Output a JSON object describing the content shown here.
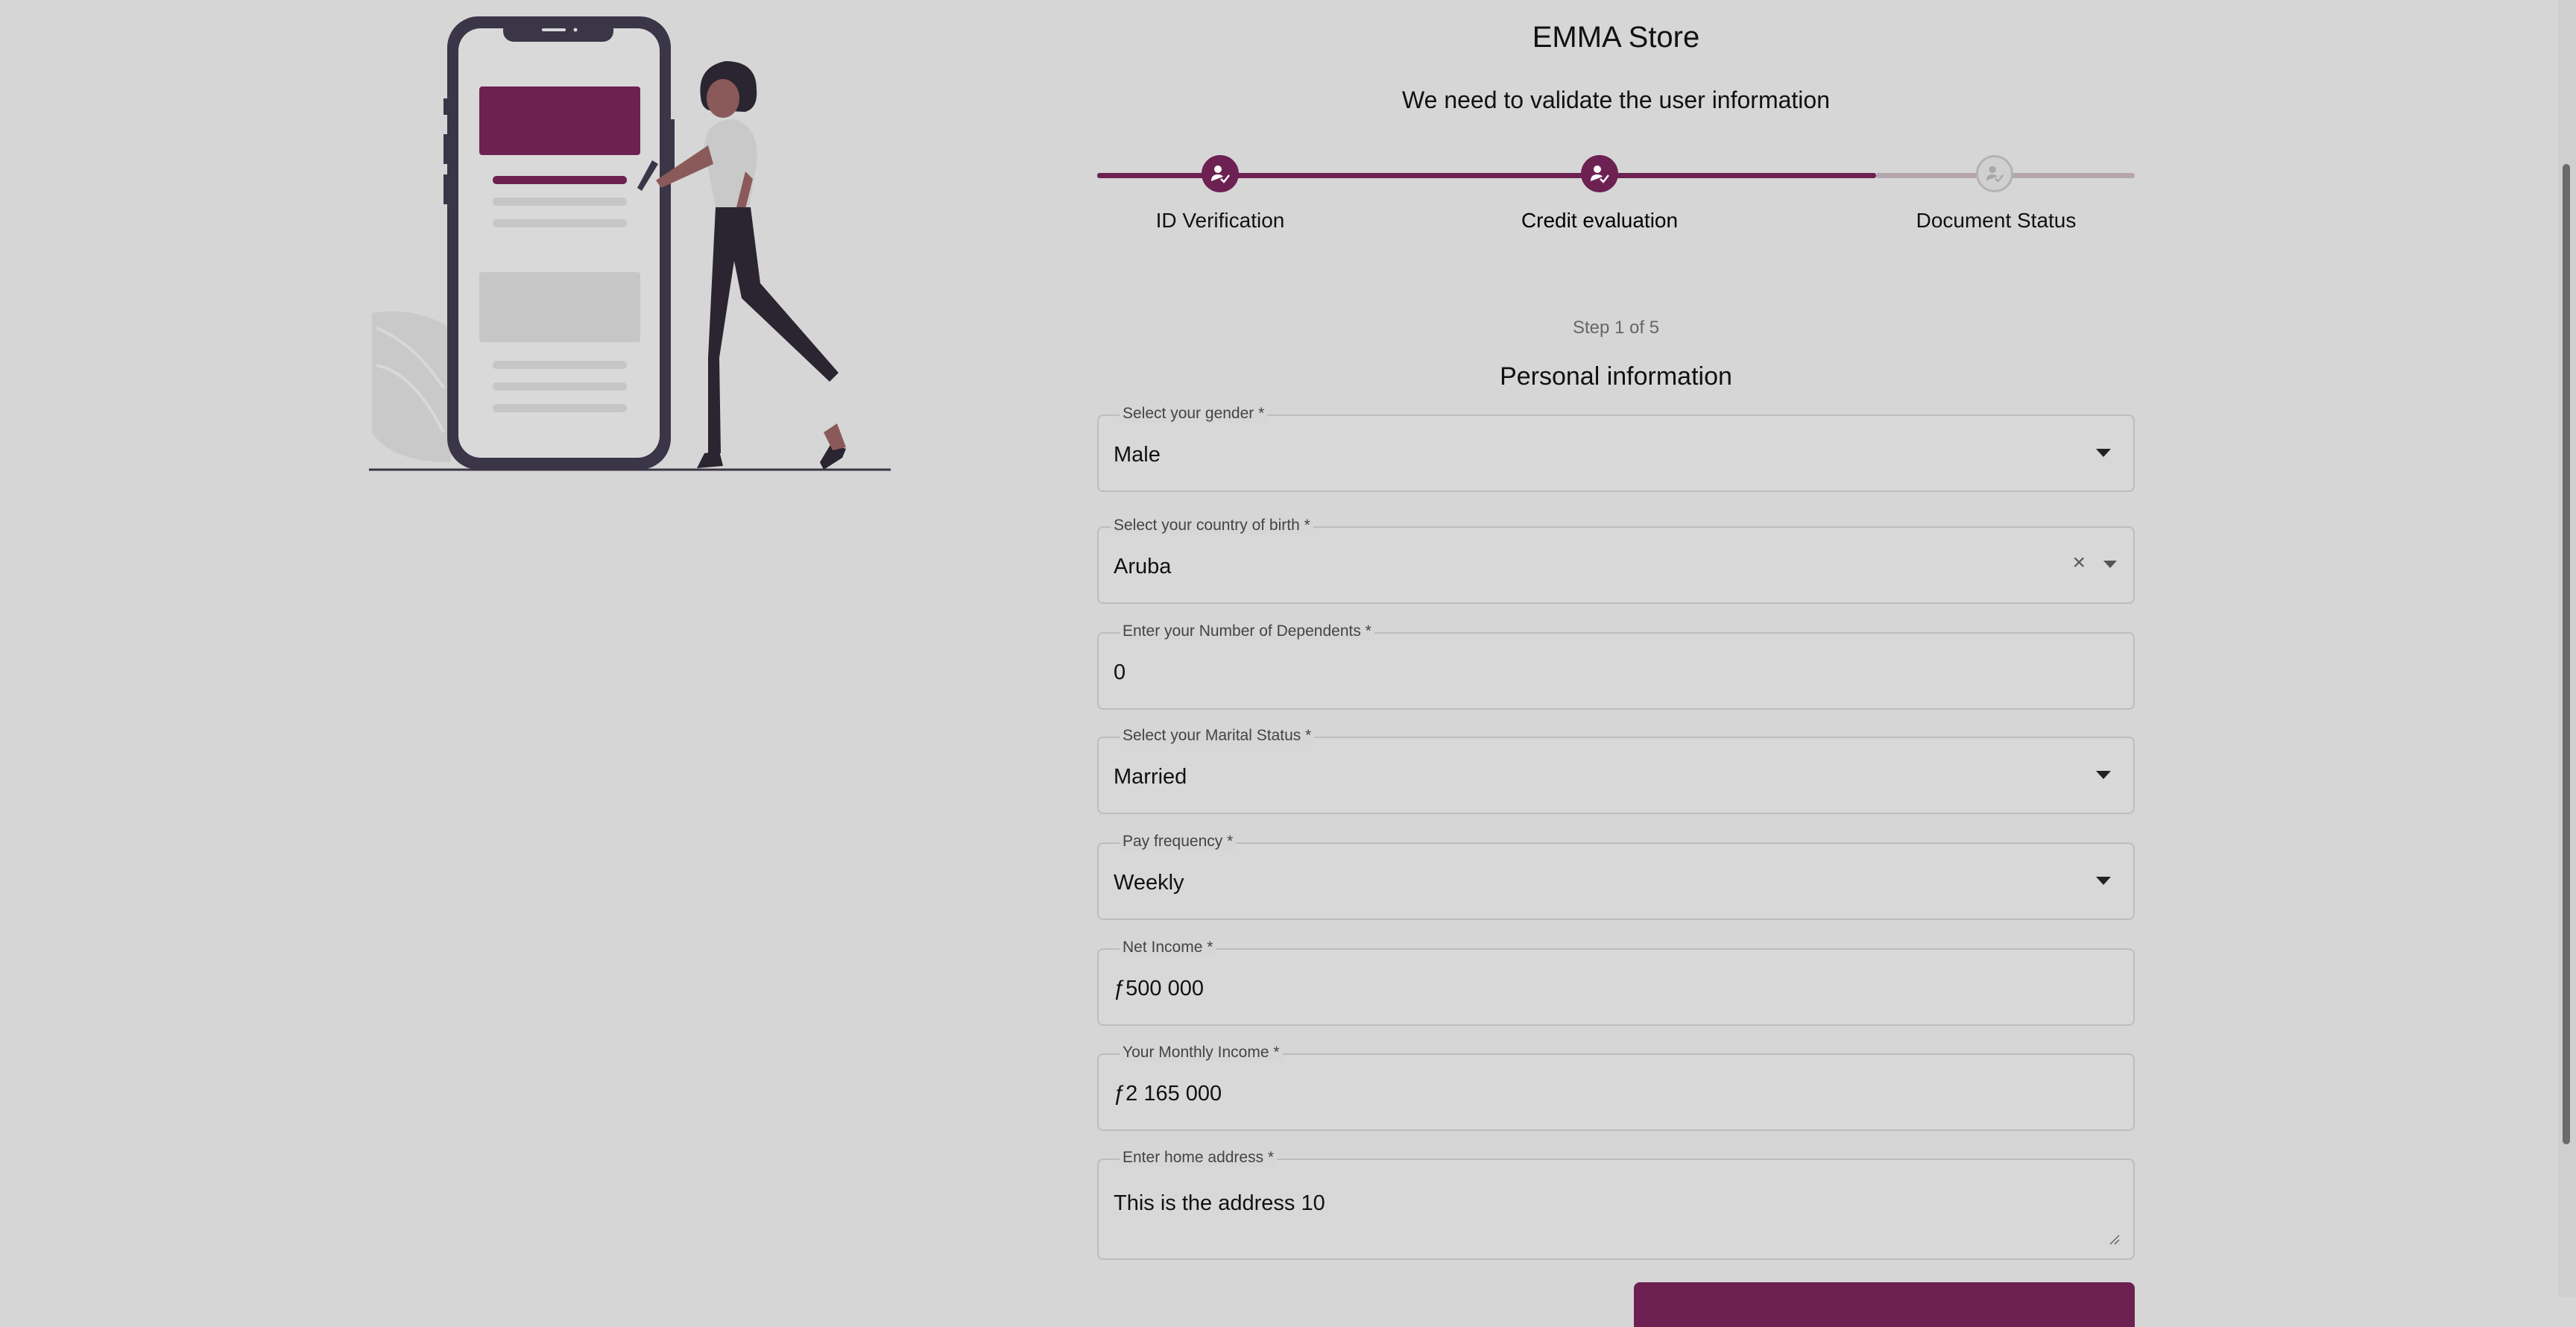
{
  "app": {
    "title": "EMMA Store",
    "subtitle": "We need to validate the user information"
  },
  "stepper": {
    "steps": [
      {
        "label": "ID Verification",
        "state": "completed",
        "icon": "user-check-icon"
      },
      {
        "label": "Credit evaluation",
        "state": "active",
        "icon": "user-check-icon"
      },
      {
        "label": "Document Status",
        "state": "pending",
        "icon": "user-check-icon"
      }
    ]
  },
  "form": {
    "step_counter": "Step 1 of 5",
    "section_title": "Personal information",
    "fields": {
      "gender": {
        "label": "Select your gender *",
        "value": "Male"
      },
      "country": {
        "label": "Select your country of birth *",
        "value": "Aruba",
        "clear_icon": "×"
      },
      "dependents": {
        "label": "Enter your Number of Dependents *",
        "value": "0"
      },
      "marital": {
        "label": "Select your Marital Status *",
        "value": "Married"
      },
      "pay_frequency": {
        "label": "Pay frequency *",
        "value": "Weekly"
      },
      "net_income": {
        "label": "Net Income *",
        "value": "ƒ500 000"
      },
      "monthly_income": {
        "label": "Your Monthly Income *",
        "value": "ƒ2 165 000"
      },
      "address": {
        "label": "Enter home address *",
        "value": "This is the address 10"
      }
    }
  },
  "colors": {
    "accent": "#6d2153",
    "background": "#d6d6d6",
    "track_inactive": "#b4a5ae"
  }
}
